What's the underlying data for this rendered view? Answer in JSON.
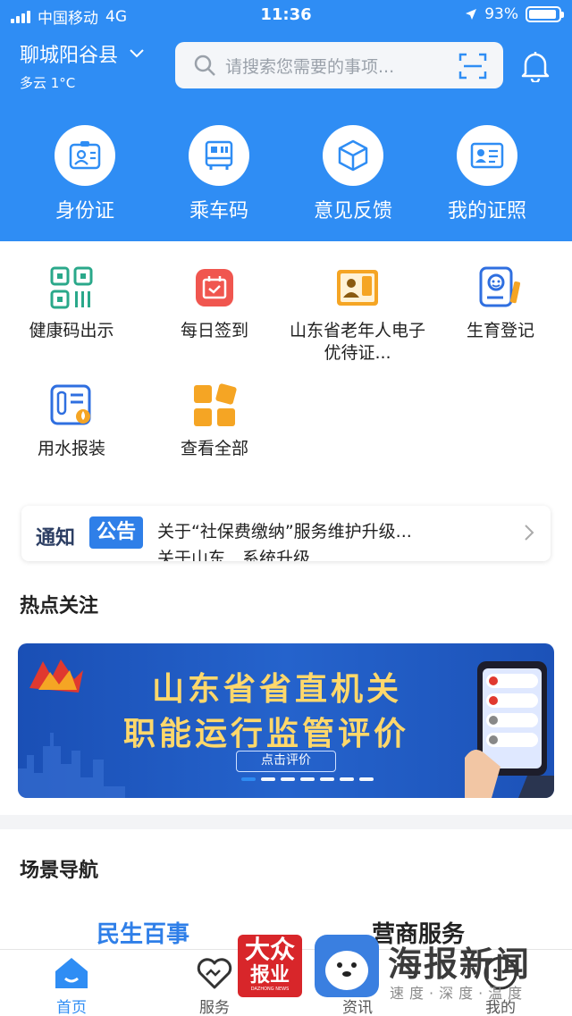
{
  "status_bar": {
    "carrier": "中国移动",
    "network": "4G",
    "time": "11:36",
    "battery": "93%",
    "battery_level": 0.93
  },
  "header": {
    "city": "聊城阳谷县",
    "weather": "多云 1°C",
    "search_placeholder": "请搜索您需要的事项..."
  },
  "top_shortcuts": [
    {
      "label": "身份证",
      "icon": "id-card-icon"
    },
    {
      "label": "乘车码",
      "icon": "bus-code-icon"
    },
    {
      "label": "意见反馈",
      "icon": "feedback-cube-icon"
    },
    {
      "label": "我的证照",
      "icon": "license-icon"
    }
  ],
  "services": [
    {
      "label": "健康码出示",
      "icon": "qr-code-icon"
    },
    {
      "label": "每日签到",
      "icon": "calendar-checkin-icon"
    },
    {
      "label": "山东省老年人电子优待证...",
      "icon": "elder-card-icon"
    },
    {
      "label": "生育登记",
      "icon": "birth-registration-icon"
    },
    {
      "label": "用水报装",
      "icon": "water-install-icon"
    },
    {
      "label": "查看全部",
      "icon": "all-services-icon"
    }
  ],
  "notice": {
    "tag1": "通知",
    "tag2": "公告",
    "text": "关于“社保费缴纳”服务维护升级...",
    "next_text": "关于山东…系统升级…"
  },
  "hot_topics": {
    "title": "热点关注",
    "banner": {
      "line1": "山东省省直机关",
      "line2": "职能运行监管评价",
      "button": "点击评价",
      "slide_count": 7,
      "active_slide": 0
    }
  },
  "scene_nav": {
    "title": "场景导航",
    "tabs": [
      "民生百事",
      "营商服务"
    ]
  },
  "bottom_nav": [
    {
      "label": "首页",
      "icon": "home-icon",
      "active": true
    },
    {
      "label": "服务",
      "icon": "heart-icon",
      "active": false
    },
    {
      "label": "资讯",
      "icon": "news-icon",
      "active": false
    },
    {
      "label": "我的",
      "icon": "user-icon",
      "active": false
    }
  ],
  "watermark": {
    "logo1_line1": "大众",
    "logo1_line2": "报业",
    "logo1_line3": "DAZHONG NEWS",
    "title": "海报新闻",
    "subtitle": "速度·深度·温度"
  },
  "colors": {
    "primary": "#2f8df4",
    "active_tab": "#2f7fe8"
  }
}
